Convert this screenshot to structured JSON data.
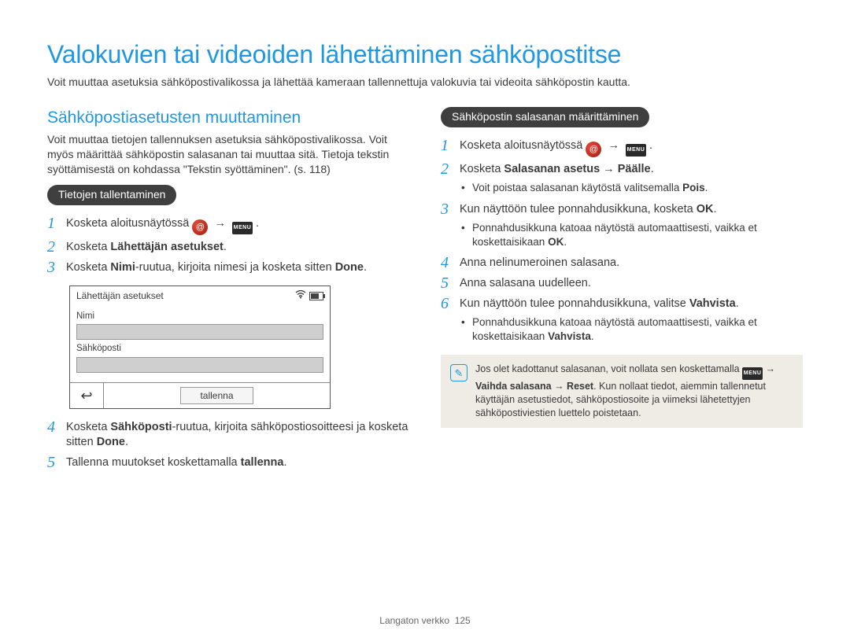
{
  "title": "Valokuvien tai videoiden lähettäminen sähköpostitse",
  "intro": "Voit muuttaa asetuksia sähköpostivalikossa ja lähettää kameraan tallennettuja valokuvia tai videoita sähköpostin kautta.",
  "left": {
    "section_heading": "Sähköpostiasetusten muuttaminen",
    "sub_intro": "Voit muuttaa tietojen tallennuksen asetuksia sähköpostivalikossa. Voit myös määrittää sähköpostin salasanan tai muuttaa sitä. Tietoja tekstin syöttämisestä on kohdassa \"Tekstin syöttäminen\". (s. 118)",
    "pill": "Tietojen tallentaminen",
    "steps": {
      "s1_a": "Kosketa aloitusnäytössä ",
      "s1_b": ".",
      "s2_a": "Kosketa ",
      "s2_bold": "Lähettäjän asetukset",
      "s2_c": ".",
      "s3_a": "Kosketa ",
      "s3_bold1": "Nimi",
      "s3_b": "-ruutua, kirjoita nimesi ja kosketa sitten ",
      "s3_bold2": "Done",
      "s3_c": ".",
      "s4_a": "Kosketa ",
      "s4_bold1": "Sähköposti",
      "s4_b": "-ruutua, kirjoita sähköpostiosoitteesi ja kosketa sitten ",
      "s4_bold2": "Done",
      "s4_c": ".",
      "s5_a": "Tallenna muutokset koskettamalla ",
      "s5_bold": "tallenna",
      "s5_c": "."
    },
    "mock": {
      "title": "Lähettäjän asetukset",
      "name_label": "Nimi",
      "email_label": "Sähköposti",
      "save": "tallenna"
    }
  },
  "right": {
    "pill": "Sähköpostin salasanan määrittäminen",
    "steps": {
      "r1_a": "Kosketa aloitusnäytössä ",
      "r1_b": ".",
      "r2_a": "Kosketa ",
      "r2_bold1": "Salasanan asetus",
      "r2_arrow": " → ",
      "r2_bold2": "Päälle",
      "r2_c": ".",
      "r2_bullet_a": "Voit poistaa salasanan käytöstä valitsemalla ",
      "r2_bullet_bold": "Pois",
      "r2_bullet_c": ".",
      "r3_a": "Kun näyttöön tulee ponnahdusikkuna, kosketa ",
      "r3_bold": "OK",
      "r3_c": ".",
      "r3_bullet_a": "Ponnahdusikkuna katoaa näytöstä automaattisesti, vaikka et koskettaisikaan ",
      "r3_bullet_bold": "OK",
      "r3_bullet_c": ".",
      "r4": "Anna nelinumeroinen salasana.",
      "r5": "Anna salasana uudelleen.",
      "r6_a": "Kun näyttöön tulee ponnahdusikkuna, valitse ",
      "r6_bold": "Vahvista",
      "r6_c": ".",
      "r6_bullet_a": "Ponnahdusikkuna katoaa näytöstä automaattisesti, vaikka et koskettaisikaan ",
      "r6_bullet_bold": "Vahvista",
      "r6_bullet_c": "."
    },
    "note": {
      "a": "Jos olet kadottanut salasanan, voit nollata sen koskettamalla ",
      "arrow": " → ",
      "bold1": "Vaihda salasana",
      "arrow2": " → ",
      "bold2": "Reset",
      "c": ". Kun nollaat tiedot, aiemmin tallennetut käyttäjän asetustiedot, sähköpostiosoite ja viimeksi lähetettyjen sähköpostiviestien luettelo poistetaan."
    }
  },
  "icons": {
    "menu_label": "MENU"
  },
  "footer": {
    "section": "Langaton verkko",
    "page": "125"
  }
}
